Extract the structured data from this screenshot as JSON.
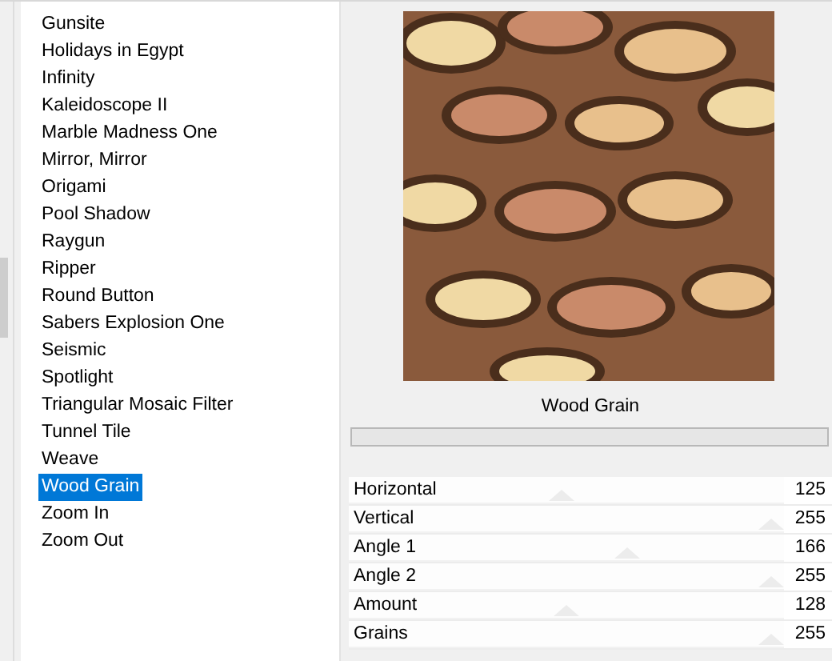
{
  "effects": [
    {
      "label": "Gunsite",
      "selected": false
    },
    {
      "label": "Holidays in Egypt",
      "selected": false
    },
    {
      "label": "Infinity",
      "selected": false
    },
    {
      "label": "Kaleidoscope II",
      "selected": false
    },
    {
      "label": "Marble Madness One",
      "selected": false
    },
    {
      "label": "Mirror, Mirror",
      "selected": false
    },
    {
      "label": "Origami",
      "selected": false
    },
    {
      "label": "Pool Shadow",
      "selected": false
    },
    {
      "label": "Raygun",
      "selected": false
    },
    {
      "label": "Ripper",
      "selected": false
    },
    {
      "label": "Round Button",
      "selected": false
    },
    {
      "label": "Sabers Explosion One",
      "selected": false
    },
    {
      "label": "Seismic",
      "selected": false
    },
    {
      "label": "Spotlight",
      "selected": false
    },
    {
      "label": "Triangular Mosaic Filter",
      "selected": false
    },
    {
      "label": "Tunnel Tile",
      "selected": false
    },
    {
      "label": "Weave",
      "selected": false
    },
    {
      "label": "Wood Grain",
      "selected": true
    },
    {
      "label": "Zoom In",
      "selected": false
    },
    {
      "label": "Zoom Out",
      "selected": false
    }
  ],
  "filter_title": "Wood Grain",
  "parameters": [
    {
      "name": "Horizontal",
      "value": "125",
      "level": 0.49
    },
    {
      "name": "Vertical",
      "value": "255",
      "level": 1
    },
    {
      "name": "Angle 1",
      "value": "166",
      "level": 0.65
    },
    {
      "name": "Angle 2",
      "value": "255",
      "level": 1
    },
    {
      "name": "Amount",
      "value": "128",
      "level": 0.5
    },
    {
      "name": "Grains",
      "value": "255",
      "level": 1
    }
  ]
}
